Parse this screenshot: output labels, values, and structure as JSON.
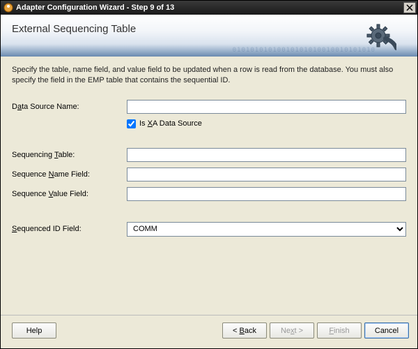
{
  "window": {
    "title": "Adapter Configuration Wizard - Step 9 of 13"
  },
  "header": {
    "title": "External Sequencing Table",
    "binary_decor": "01010101010010101010010010101010"
  },
  "intro": "Specify the table, name field, and value field to be updated when a row is read from the database.  You must also specify the field in the EMP table that contains the sequential ID.",
  "labels": {
    "data_source_name_pre": "D",
    "data_source_name_u": "a",
    "data_source_name_post": "ta Source Name:",
    "is_xa_pre": "Is ",
    "is_xa_u": "X",
    "is_xa_post": "A Data Source",
    "seq_table_pre": "Sequencing ",
    "seq_table_u": "T",
    "seq_table_post": "able:",
    "seq_name_pre": "Sequence ",
    "seq_name_u": "N",
    "seq_name_post": "ame Field:",
    "seq_value_pre": "Sequence ",
    "seq_value_u": "V",
    "seq_value_post": "alue Field:",
    "seq_id_pre": "",
    "seq_id_u": "S",
    "seq_id_post": "equenced ID Field:"
  },
  "fields": {
    "data_source_name": "",
    "is_xa": true,
    "sequencing_table": "",
    "sequence_name_field": "",
    "sequence_value_field": "",
    "sequenced_id_field": "COMM"
  },
  "buttons": {
    "help": "Help",
    "back_pre": "< ",
    "back_u": "B",
    "back_post": "ack",
    "next_pre": "Ne",
    "next_u": "x",
    "next_post": "t >",
    "finish_pre": "",
    "finish_u": "F",
    "finish_post": "inish",
    "cancel": "Cancel"
  }
}
